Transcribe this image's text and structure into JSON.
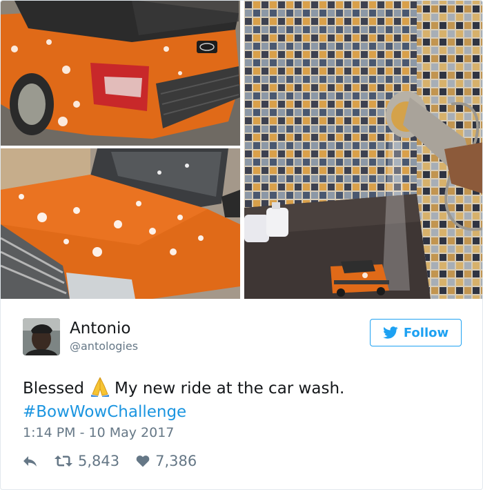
{
  "tweet": {
    "author_name": "Antonio",
    "author_handle": "@antologies",
    "follow_label": "Follow",
    "text_before_emoji": "Blessed",
    "emoji_name": "folded-hands-emoji",
    "text_after_emoji": "My new ride at the car wash.",
    "hashtag": "#BowWowChallenge",
    "timestamp": "1:14 PM - 10 May 2017",
    "retweet_count": "5,843",
    "like_count": "7,386"
  },
  "colors": {
    "accent": "#1da1f2",
    "hashtag": "#1b95e0",
    "secondary_text": "#657786",
    "car_orange": "#e06a18"
  },
  "icons": {
    "reply": "reply-icon",
    "retweet": "retweet-icon",
    "like": "heart-icon",
    "twitter": "twitter-bird-icon"
  }
}
